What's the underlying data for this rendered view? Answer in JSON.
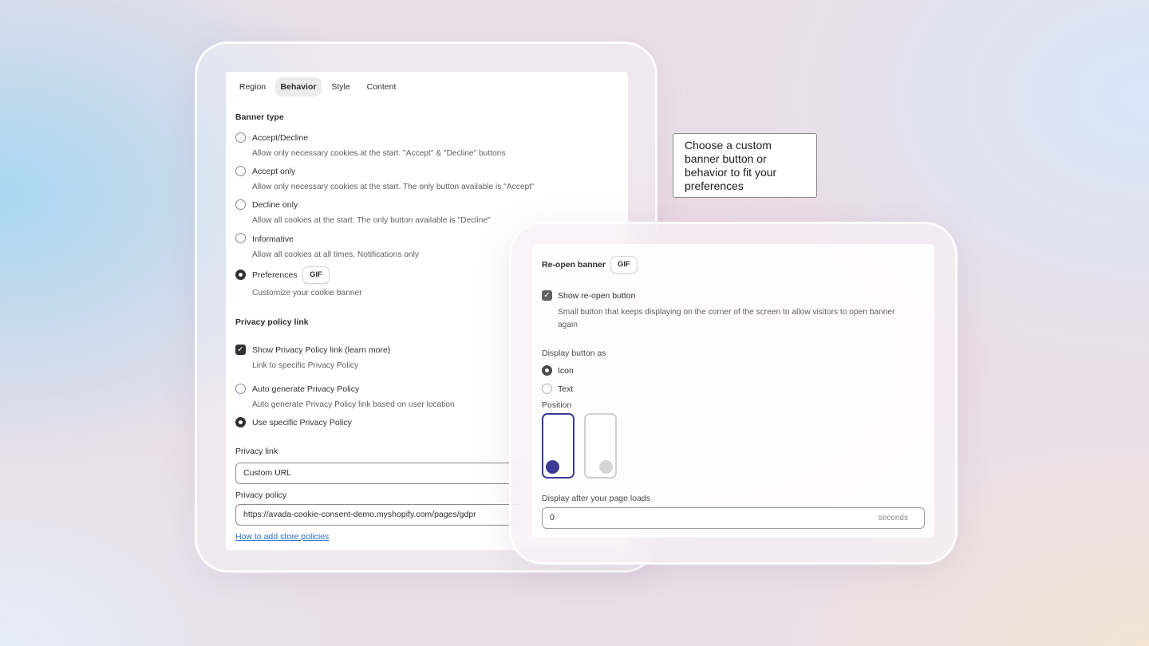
{
  "tabs": [
    {
      "label": "Region",
      "active": false
    },
    {
      "label": "Behavior",
      "active": true
    },
    {
      "label": "Style",
      "active": false
    },
    {
      "label": "Content",
      "active": false
    }
  ],
  "banner_type": {
    "title": "Banner type",
    "options": [
      {
        "label": "Accept/Decline",
        "desc": "Allow only necessary cookies at the start. \"Accept\" & \"Decline\" buttons",
        "checked": false
      },
      {
        "label": "Accept only",
        "desc": "Allow only necessary cookies at the start. The only button available is \"Accept\"",
        "checked": false
      },
      {
        "label": "Decline only",
        "desc": "Allow all cookies at the start. The only button available is \"Decline\"",
        "checked": false
      },
      {
        "label": "Informative",
        "desc": "Allow all cookies at all times. Notifications only",
        "checked": false
      },
      {
        "label": "Preferences",
        "desc": "Customize your cookie banner",
        "checked": true,
        "badge": "GIF"
      }
    ]
  },
  "privacy": {
    "title": "Privacy policy link",
    "show_link": {
      "label": "Show Privacy Policy link (learn more)",
      "desc": "Link to specific Privacy Policy",
      "checked": true
    },
    "auto_generate": {
      "label": "Auto generate Privacy Policy",
      "desc": "Auto generate Privacy Policy link based on user location",
      "checked": false
    },
    "use_specific": {
      "label": "Use specific Privacy Policy",
      "checked": true
    },
    "privacy_link_label": "Privacy link",
    "privacy_link_value": "Custom URL",
    "privacy_policy_label": "Privacy policy",
    "privacy_policy_value": "https://avada-cookie-consent-demo.myshopify.com/pages/gdpr",
    "help_link": "How to add store policies"
  },
  "tooltip": {
    "text": "Choose a custom banner button or behavior to fit your preferences"
  },
  "reopen": {
    "title": "Re-open banner",
    "badge": "GIF",
    "show_button": {
      "label": "Show re-open button",
      "desc": "Small button that keeps displaying on the corner of the screen to allow visitors to open banner again",
      "checked": true
    },
    "display_as_label": "Display button as",
    "display_options": [
      {
        "label": "Icon",
        "checked": true
      },
      {
        "label": "Text",
        "checked": false
      }
    ],
    "position_label": "Position",
    "positions": [
      {
        "name": "bottom-left",
        "selected": true,
        "color": "#3b3c96"
      },
      {
        "name": "bottom-right",
        "selected": false,
        "color": "#d4d4d4"
      }
    ],
    "delay_label": "Display after your page loads",
    "delay_value": "0",
    "delay_suffix": "seconds"
  }
}
